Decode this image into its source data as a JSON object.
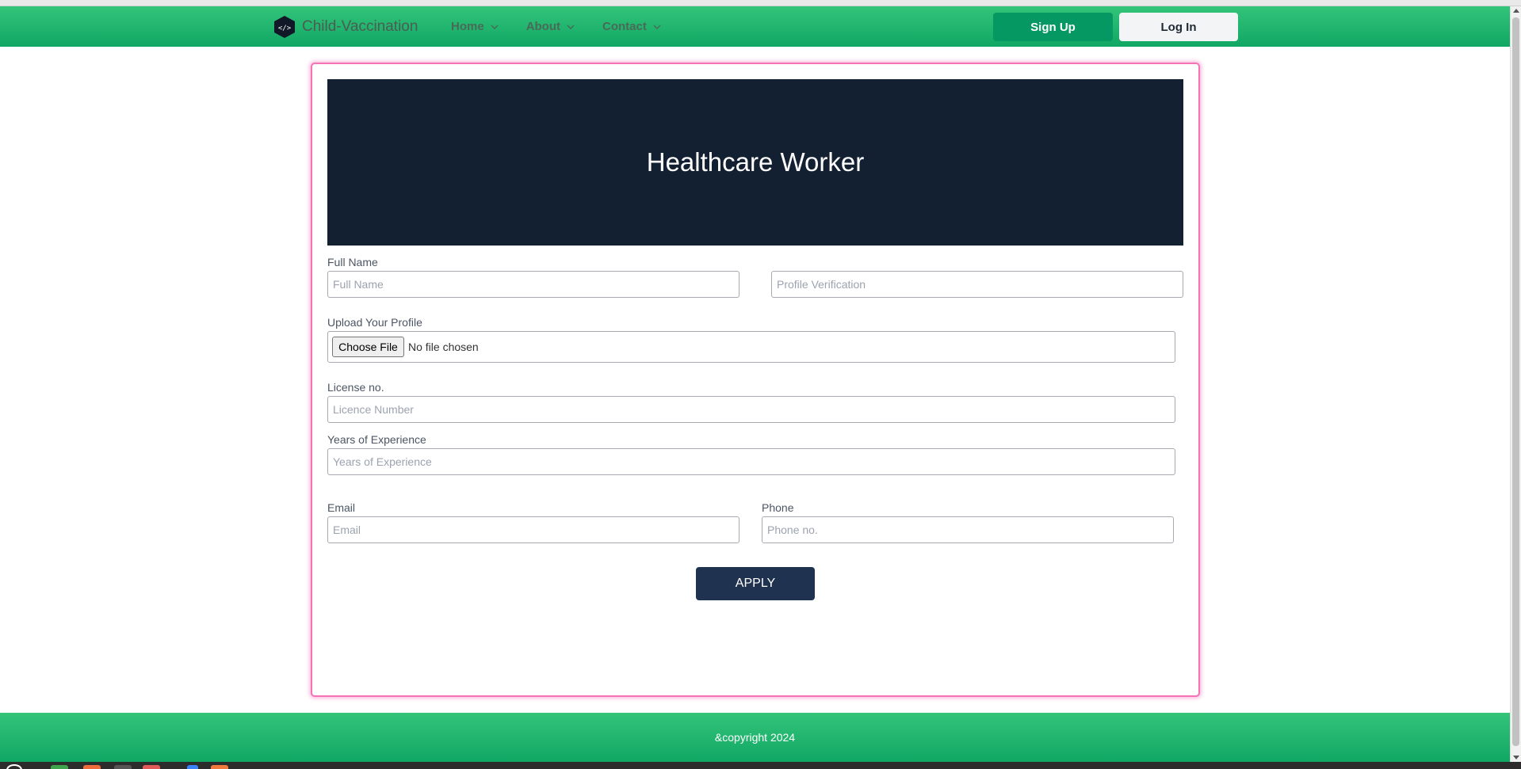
{
  "navbar": {
    "brand": "Child-Vaccination",
    "menu": [
      {
        "label": "Home"
      },
      {
        "label": "About"
      },
      {
        "label": "Contact"
      }
    ],
    "signup_label": "Sign Up",
    "login_label": "Log In"
  },
  "form": {
    "title": "Healthcare Worker",
    "full_name": {
      "label": "Full Name",
      "placeholder": "Full Name"
    },
    "profile_verification": {
      "placeholder": "Profile Verification"
    },
    "upload": {
      "label": "Upload Your Profile",
      "button": "Choose File",
      "status": "No file chosen"
    },
    "license": {
      "label": "License no.",
      "placeholder": "Licence Number"
    },
    "experience": {
      "label": "Years of Experience",
      "placeholder": "Years of Experience"
    },
    "email": {
      "label": "Email",
      "placeholder": "Email"
    },
    "phone": {
      "label": "Phone",
      "placeholder": "Phone no."
    },
    "apply_label": "APPLY"
  },
  "footer": {
    "text": "&copyright 2024"
  },
  "colors": {
    "navbar": "#10a764",
    "signup_button": "#059862",
    "hero_background": "#132032",
    "apply_button": "#1f3350",
    "card_border": "#f472b6"
  },
  "icons": [
    "code-logo-icon",
    "chevron-down-icon"
  ]
}
